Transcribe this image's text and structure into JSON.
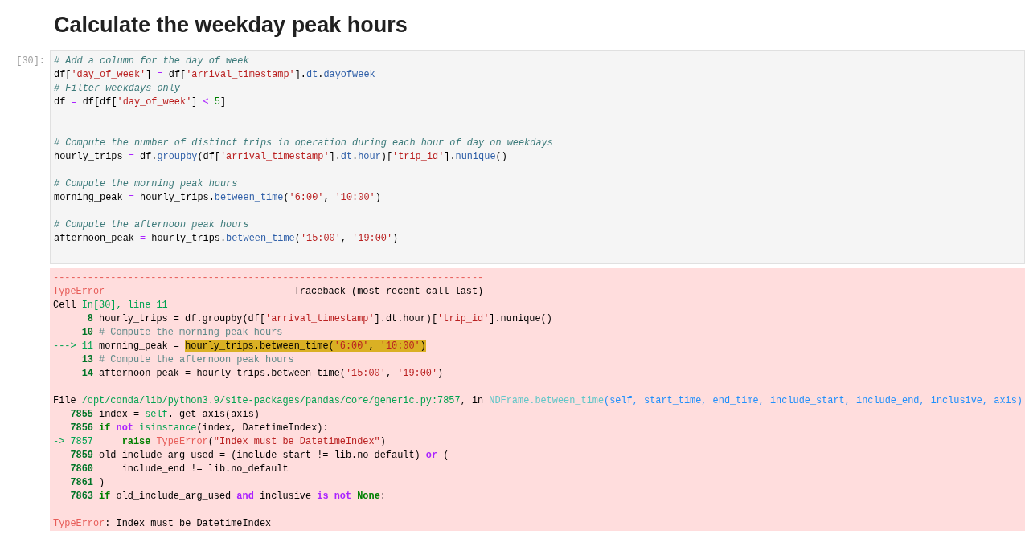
{
  "heading": "Calculate the weekday peak hours",
  "cell": {
    "prompt": "[30]:",
    "input_lines": [
      {
        "kind": "code",
        "tokens": [
          {
            "kind": "comment",
            "text": "# Add a column for the day of week"
          }
        ]
      },
      {
        "kind": "code",
        "tokens": [
          {
            "kind": "plain",
            "text": "df["
          },
          {
            "kind": "string",
            "text": "'day_of_week'"
          },
          {
            "kind": "plain",
            "text": "] "
          },
          {
            "kind": "op",
            "text": "="
          },
          {
            "kind": "plain",
            "text": " df["
          },
          {
            "kind": "string",
            "text": "'arrival_timestamp'"
          },
          {
            "kind": "plain",
            "text": "]."
          },
          {
            "kind": "attr",
            "text": "dt"
          },
          {
            "kind": "plain",
            "text": "."
          },
          {
            "kind": "attr",
            "text": "dayofweek"
          }
        ]
      },
      {
        "kind": "code",
        "tokens": [
          {
            "kind": "comment",
            "text": "# Filter weekdays only"
          }
        ]
      },
      {
        "kind": "code",
        "tokens": [
          {
            "kind": "plain",
            "text": "df "
          },
          {
            "kind": "op",
            "text": "="
          },
          {
            "kind": "plain",
            "text": " df[df["
          },
          {
            "kind": "string",
            "text": "'day_of_week'"
          },
          {
            "kind": "plain",
            "text": "] "
          },
          {
            "kind": "op",
            "text": "< "
          },
          {
            "kind": "number",
            "text": "5"
          },
          {
            "kind": "plain",
            "text": "]"
          }
        ]
      },
      {
        "kind": "blank"
      },
      {
        "kind": "blank"
      },
      {
        "kind": "code",
        "tokens": [
          {
            "kind": "comment",
            "text": "# Compute the number of distinct trips in operation during each hour of day on weekdays"
          }
        ]
      },
      {
        "kind": "code",
        "tokens": [
          {
            "kind": "plain",
            "text": "hourly_trips "
          },
          {
            "kind": "op",
            "text": "="
          },
          {
            "kind": "plain",
            "text": " df."
          },
          {
            "kind": "attr",
            "text": "groupby"
          },
          {
            "kind": "plain",
            "text": "(df["
          },
          {
            "kind": "string",
            "text": "'arrival_timestamp'"
          },
          {
            "kind": "plain",
            "text": "]."
          },
          {
            "kind": "attr",
            "text": "dt"
          },
          {
            "kind": "plain",
            "text": "."
          },
          {
            "kind": "attr",
            "text": "hour"
          },
          {
            "kind": "plain",
            "text": ")["
          },
          {
            "kind": "string",
            "text": "'trip_id'"
          },
          {
            "kind": "plain",
            "text": "]."
          },
          {
            "kind": "attr",
            "text": "nunique"
          },
          {
            "kind": "plain",
            "text": "()"
          }
        ]
      },
      {
        "kind": "blank"
      },
      {
        "kind": "code",
        "tokens": [
          {
            "kind": "comment",
            "text": "# Compute the morning peak hours"
          }
        ]
      },
      {
        "kind": "code",
        "tokens": [
          {
            "kind": "plain",
            "text": "morning_peak "
          },
          {
            "kind": "op",
            "text": "="
          },
          {
            "kind": "plain",
            "text": " hourly_trips."
          },
          {
            "kind": "attr",
            "text": "between_time"
          },
          {
            "kind": "plain",
            "text": "("
          },
          {
            "kind": "string",
            "text": "'6:00'"
          },
          {
            "kind": "plain",
            "text": ", "
          },
          {
            "kind": "string",
            "text": "'10:00'"
          },
          {
            "kind": "plain",
            "text": ")"
          }
        ]
      },
      {
        "kind": "blank"
      },
      {
        "kind": "code",
        "tokens": [
          {
            "kind": "comment",
            "text": "# Compute the afternoon peak hours"
          }
        ]
      },
      {
        "kind": "code",
        "tokens": [
          {
            "kind": "plain",
            "text": "afternoon_peak "
          },
          {
            "kind": "op",
            "text": "="
          },
          {
            "kind": "plain",
            "text": " hourly_trips."
          },
          {
            "kind": "attr",
            "text": "between_time"
          },
          {
            "kind": "plain",
            "text": "("
          },
          {
            "kind": "string",
            "text": "'15:00'"
          },
          {
            "kind": "plain",
            "text": ", "
          },
          {
            "kind": "string",
            "text": "'19:00'"
          },
          {
            "kind": "plain",
            "text": ")"
          }
        ]
      }
    ],
    "output_lines": [
      {
        "kind": "code",
        "tokens": [
          {
            "kind": "red",
            "text": "---------------------------------------------------------------------------"
          }
        ]
      },
      {
        "kind": "code",
        "tokens": [
          {
            "kind": "red",
            "text": "TypeError"
          },
          {
            "kind": "plain",
            "text": "                                 Traceback (most recent call last)"
          }
        ]
      },
      {
        "kind": "code",
        "tokens": [
          {
            "kind": "plain",
            "text": "Cell "
          },
          {
            "kind": "green",
            "text": "In[30], line 11"
          }
        ]
      },
      {
        "kind": "code",
        "tokens": [
          {
            "kind": "lineno",
            "text": "      8"
          },
          {
            "kind": "plain",
            "text": " hourly_trips = df.groupby(df["
          },
          {
            "kind": "string",
            "text": "'arrival_timestamp'"
          },
          {
            "kind": "plain",
            "text": "].dt.hour)["
          },
          {
            "kind": "string",
            "text": "'trip_id'"
          },
          {
            "kind": "plain",
            "text": "].nunique()"
          }
        ]
      },
      {
        "kind": "code",
        "tokens": [
          {
            "kind": "lineno",
            "text": "     10 "
          },
          {
            "kind": "tbcomment",
            "text": "# Compute the morning peak hours"
          }
        ]
      },
      {
        "kind": "code",
        "tokens": [
          {
            "kind": "green",
            "text": "---> 11"
          },
          {
            "kind": "plain",
            "text": " morning_peak = "
          },
          {
            "kind": "hl",
            "text": "hourly_trips.between_time("
          },
          {
            "kind": "hlstring",
            "text": "'6:00'"
          },
          {
            "kind": "hl",
            "text": ", "
          },
          {
            "kind": "hlstring",
            "text": "'10:00'"
          },
          {
            "kind": "hl",
            "text": ")"
          }
        ]
      },
      {
        "kind": "code",
        "tokens": [
          {
            "kind": "lineno",
            "text": "     13 "
          },
          {
            "kind": "tbcomment",
            "text": "# Compute the afternoon peak hours"
          }
        ]
      },
      {
        "kind": "code",
        "tokens": [
          {
            "kind": "lineno",
            "text": "     14"
          },
          {
            "kind": "plain",
            "text": " afternoon_peak = hourly_trips.between_time("
          },
          {
            "kind": "string",
            "text": "'15:00'"
          },
          {
            "kind": "plain",
            "text": ", "
          },
          {
            "kind": "string",
            "text": "'19:00'"
          },
          {
            "kind": "plain",
            "text": ")"
          }
        ]
      },
      {
        "kind": "blank"
      },
      {
        "kind": "code",
        "tokens": [
          {
            "kind": "plain",
            "text": "File "
          },
          {
            "kind": "green",
            "text": "/opt/conda/lib/python3.9/site-packages/pandas/core/generic.py:7857"
          },
          {
            "kind": "plain",
            "text": ", in "
          },
          {
            "kind": "cyan",
            "text": "NDFrame.between_time"
          },
          {
            "kind": "blue",
            "text": "(self, start_time, end_time, include_start, include_end, inclusive, axis)"
          }
        ]
      },
      {
        "kind": "code",
        "tokens": [
          {
            "kind": "lineno",
            "text": "   7855"
          },
          {
            "kind": "plain",
            "text": " index = "
          },
          {
            "kind": "green",
            "text": "self"
          },
          {
            "kind": "plain",
            "text": "._get_axis(axis)"
          }
        ]
      },
      {
        "kind": "code",
        "tokens": [
          {
            "kind": "lineno",
            "text": "   7856 "
          },
          {
            "kind": "kw",
            "text": "if "
          },
          {
            "kind": "kwop",
            "text": "not "
          },
          {
            "kind": "green",
            "text": "isinstance"
          },
          {
            "kind": "plain",
            "text": "(index, DatetimeIndex):"
          }
        ]
      },
      {
        "kind": "code",
        "tokens": [
          {
            "kind": "green",
            "text": "-> 7857"
          },
          {
            "kind": "kw",
            "text": "     raise "
          },
          {
            "kind": "red",
            "text": "TypeError"
          },
          {
            "kind": "plain",
            "text": "("
          },
          {
            "kind": "string",
            "text": "\"Index must be DatetimeIndex\""
          },
          {
            "kind": "plain",
            "text": ")"
          }
        ]
      },
      {
        "kind": "code",
        "tokens": [
          {
            "kind": "lineno",
            "text": "   7859"
          },
          {
            "kind": "plain",
            "text": " old_include_arg_used = (include_start != lib.no_default) "
          },
          {
            "kind": "kwop",
            "text": "or"
          },
          {
            "kind": "plain",
            "text": " ("
          }
        ]
      },
      {
        "kind": "code",
        "tokens": [
          {
            "kind": "lineno",
            "text": "   7860"
          },
          {
            "kind": "plain",
            "text": "     include_end != lib.no_default"
          }
        ]
      },
      {
        "kind": "code",
        "tokens": [
          {
            "kind": "lineno",
            "text": "   7861"
          },
          {
            "kind": "plain",
            "text": " )"
          }
        ]
      },
      {
        "kind": "code",
        "tokens": [
          {
            "kind": "lineno",
            "text": "   7863 "
          },
          {
            "kind": "kw",
            "text": "if"
          },
          {
            "kind": "plain",
            "text": " old_include_arg_used "
          },
          {
            "kind": "kwop",
            "text": "and"
          },
          {
            "kind": "plain",
            "text": " inclusive "
          },
          {
            "kind": "kwop",
            "text": "is not "
          },
          {
            "kind": "kw",
            "text": "None"
          },
          {
            "kind": "plain",
            "text": ":"
          }
        ]
      },
      {
        "kind": "blank"
      },
      {
        "kind": "code",
        "tokens": [
          {
            "kind": "red",
            "text": "TypeError"
          },
          {
            "kind": "plain",
            "text": ": Index must be DatetimeIndex"
          }
        ]
      }
    ]
  }
}
